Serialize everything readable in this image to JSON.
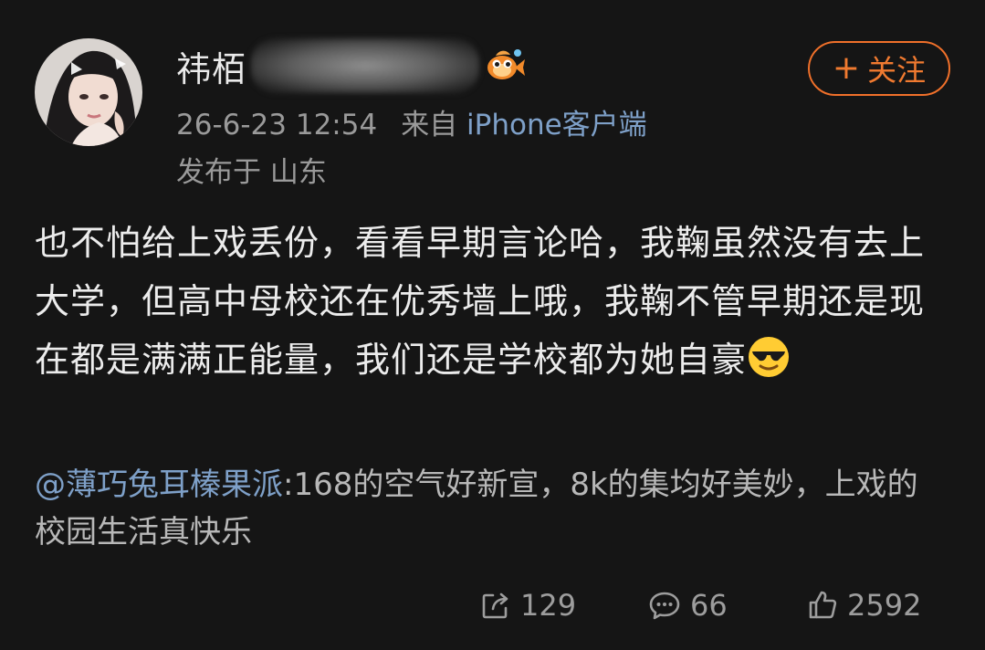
{
  "user": {
    "name_visible": "祎栢",
    "avatar_icon": "avatar-portrait",
    "badge_icon": "fish-badge-icon",
    "follow_label": "关注"
  },
  "meta": {
    "time": "26-6-23 12:54",
    "source_prefix": "来自",
    "source": "iPhone客户端",
    "location": "发布于 山东"
  },
  "post": {
    "text": "也不怕给上戏丢份，看看早期言论哈，我鞠虽然没有去上大学，但高中母校还在优秀墙上哦，我鞠不管早期还是现在都是满满正能量，我们还是学校都为她自豪",
    "emoji": "sunglasses-emoji"
  },
  "repost": {
    "mention": "@薄巧兔耳榛果派",
    "text": ":168的空气好新宣，8k的集均好美妙，上戏的校园生活真快乐"
  },
  "actions": {
    "reposts": "129",
    "comments": "66",
    "likes": "2592"
  },
  "colors": {
    "background": "#151515",
    "accent_orange": "#f07a30",
    "link_blue": "#7ea0c8"
  }
}
